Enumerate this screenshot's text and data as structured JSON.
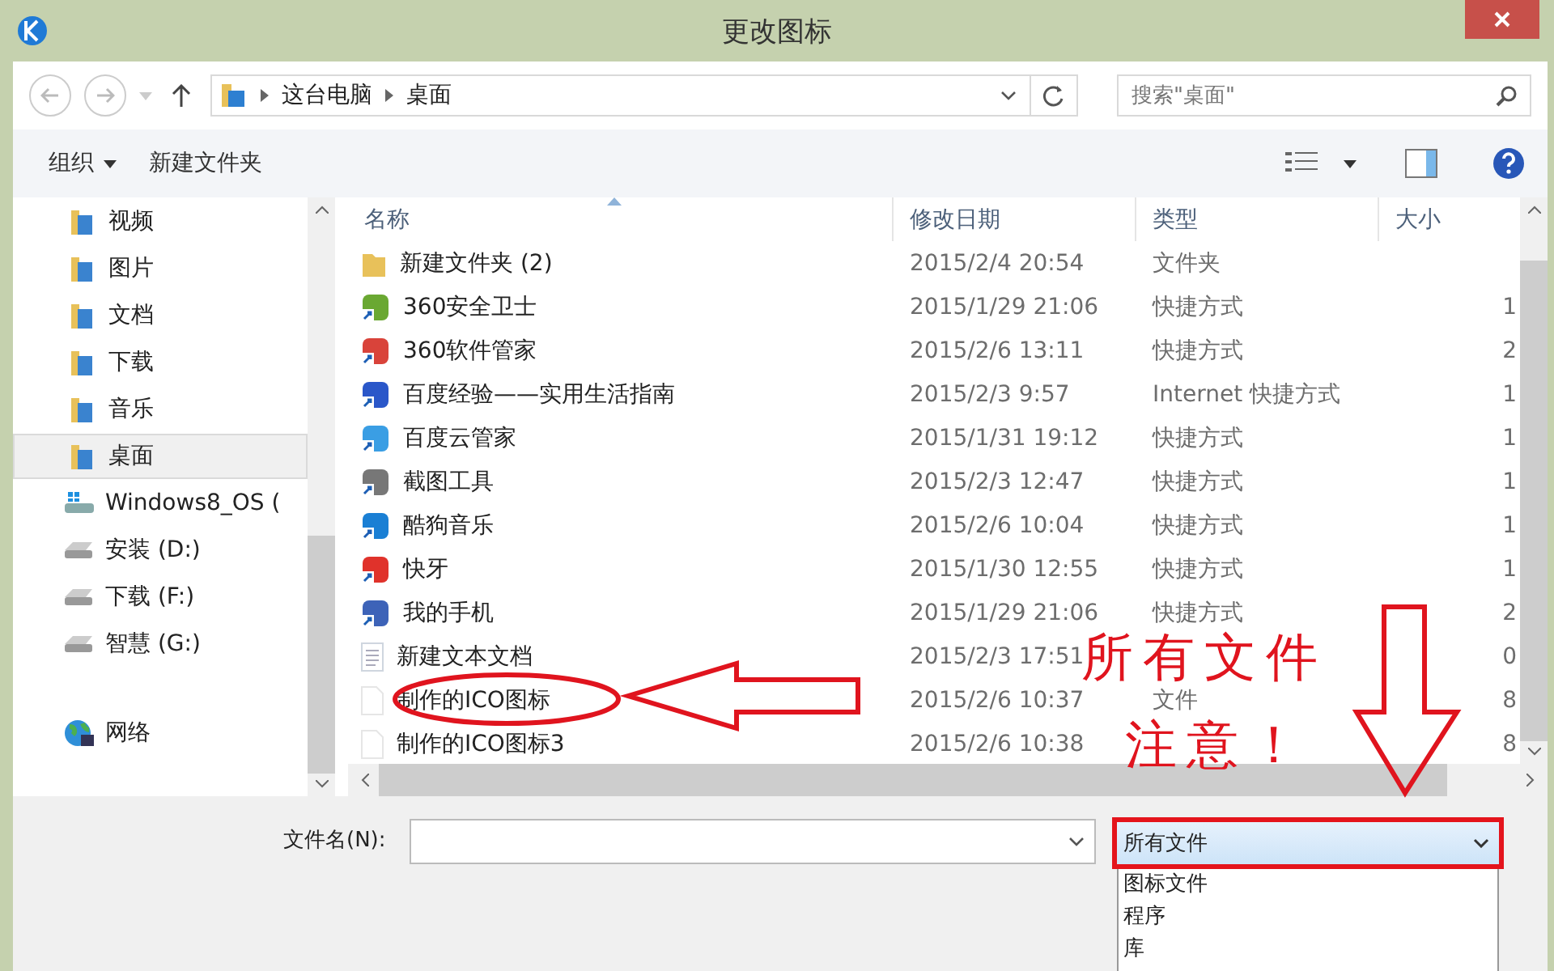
{
  "window": {
    "title": "更改图标"
  },
  "address": {
    "crumbs": [
      "这台电脑",
      "桌面"
    ],
    "search_placeholder": "搜索\"桌面\""
  },
  "toolbar": {
    "organize": "组织",
    "new_folder": "新建文件夹"
  },
  "sidebar": {
    "items": [
      {
        "label": "视频",
        "kind": "folder",
        "selected": false
      },
      {
        "label": "图片",
        "kind": "folder",
        "selected": false
      },
      {
        "label": "文档",
        "kind": "folder",
        "selected": false
      },
      {
        "label": "下载",
        "kind": "folder",
        "selected": false
      },
      {
        "label": "音乐",
        "kind": "folder",
        "selected": false
      },
      {
        "label": "桌面",
        "kind": "folder",
        "selected": true
      },
      {
        "label": "Windows8_OS (",
        "kind": "system-drive",
        "selected": false
      },
      {
        "label": "安装 (D:)",
        "kind": "drive",
        "selected": false
      },
      {
        "label": "下载 (F:)",
        "kind": "drive",
        "selected": false
      },
      {
        "label": "智慧 (G:)",
        "kind": "drive",
        "selected": false
      },
      {
        "label": "网络",
        "kind": "network",
        "selected": false
      }
    ]
  },
  "table": {
    "columns": [
      "名称",
      "修改日期",
      "类型",
      "大小"
    ],
    "rows": [
      {
        "name": "新建文件夹 (2)",
        "date": "2015/2/4 20:54",
        "type": "文件夹",
        "kind": "folder",
        "color": "#e8c15a"
      },
      {
        "name": "360安全卫士",
        "date": "2015/1/29 21:06",
        "type": "快捷方式",
        "size": "1",
        "kind": "shortcut",
        "color": "#6aa832"
      },
      {
        "name": "360软件管家",
        "date": "2015/2/6 13:11",
        "type": "快捷方式",
        "size": "2",
        "kind": "shortcut",
        "color": "#d9433a"
      },
      {
        "name": "百度经验——实用生活指南",
        "date": "2015/2/3 9:57",
        "type": "Internet 快捷方式",
        "size": "1",
        "kind": "shortcut",
        "color": "#2a57c9"
      },
      {
        "name": "百度云管家",
        "date": "2015/1/31 19:12",
        "type": "快捷方式",
        "size": "1",
        "kind": "shortcut",
        "color": "#3a9ee4"
      },
      {
        "name": "截图工具",
        "date": "2015/2/3 12:47",
        "type": "快捷方式",
        "size": "1",
        "kind": "shortcut",
        "color": "#777777"
      },
      {
        "name": "酷狗音乐",
        "date": "2015/2/6 10:04",
        "type": "快捷方式",
        "size": "1",
        "kind": "shortcut",
        "color": "#1a7fd4"
      },
      {
        "name": "快牙",
        "date": "2015/1/30 12:55",
        "type": "快捷方式",
        "size": "1",
        "kind": "shortcut",
        "color": "#e0322b"
      },
      {
        "name": "我的手机",
        "date": "2015/1/29 21:06",
        "type": "快捷方式",
        "size": "2",
        "kind": "shortcut",
        "color": "#3d63b8"
      },
      {
        "name": "新建文本文档",
        "date": "2015/2/3 17:51",
        "size": "0",
        "kind": "text",
        "color": "#cfd6df"
      },
      {
        "name": "制作的ICO图标",
        "date": "2015/2/6 10:37",
        "type": "文件",
        "size": "8",
        "kind": "file",
        "color": "#e6e6e6"
      },
      {
        "name": "制作的ICO图标3",
        "date": "2015/2/6 10:38",
        "size": "8",
        "kind": "file",
        "color": "#e6e6e6"
      }
    ]
  },
  "footer": {
    "filename_label": "文件名(N):",
    "filter": "所有文件",
    "filter_options": [
      "图标文件",
      "程序",
      "库"
    ]
  },
  "annotations": {
    "labels": [
      "所有文件",
      "注意！"
    ]
  }
}
